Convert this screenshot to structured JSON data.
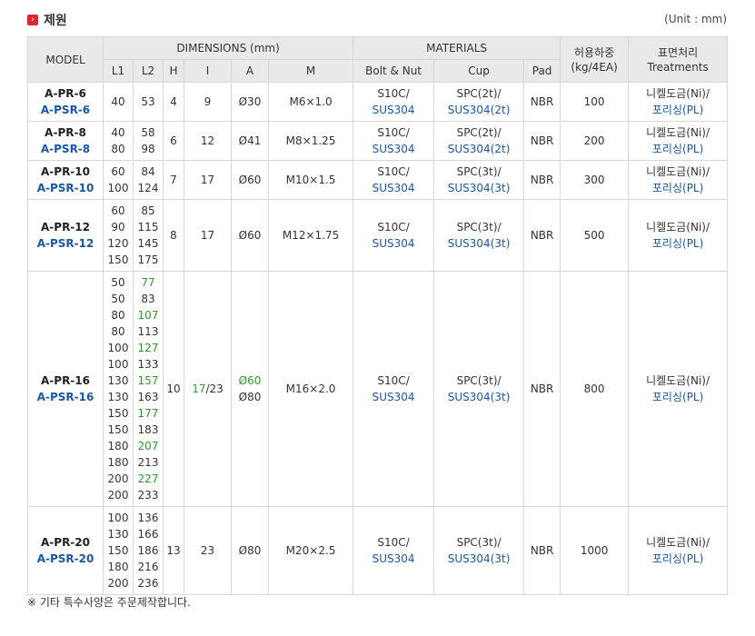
{
  "title": "제원",
  "title_icon": "arrow-right-icon",
  "unit": "(Unit : mm)",
  "headers": {
    "model": "MODEL",
    "dimensions": "DIMENSIONS (mm)",
    "materials": "MATERIALS",
    "load": "허용하중 (kg/4EA)",
    "treatment": "표면처리 Treatments",
    "l1": "L1",
    "l2": "L2",
    "h": "H",
    "i": "I",
    "a": "A",
    "m": "M",
    "bolt": "Bolt & Nut",
    "cup": "Cup",
    "pad": "Pad"
  },
  "rows": [
    {
      "model1": "A-PR-6",
      "model2": "A-PSR-6",
      "l1": [
        "40"
      ],
      "l2": [
        "53"
      ],
      "h": "4",
      "i": "9",
      "a": [
        "Ø30"
      ],
      "m": "M6×1.0",
      "bolt1": "S10C/",
      "bolt2": "SUS304",
      "cup1": "SPC(2t)/",
      "cup2": "SUS304(2t)",
      "pad": "NBR",
      "load": "100",
      "tr1": "니켈도금(Ni)/",
      "tr2": "포리싱(PL)"
    },
    {
      "model1": "A-PR-8",
      "model2": "A-PSR-8",
      "l1": [
        "40",
        "80"
      ],
      "l2": [
        "58",
        "98"
      ],
      "h": "6",
      "i": "12",
      "a": [
        "Ø41"
      ],
      "m": "M8×1.25",
      "bolt1": "S10C/",
      "bolt2": "SUS304",
      "cup1": "SPC(2t)/",
      "cup2": "SUS304(2t)",
      "pad": "NBR",
      "load": "200",
      "tr1": "니켈도금(Ni)/",
      "tr2": "포리싱(PL)"
    },
    {
      "model1": "A-PR-10",
      "model2": "A-PSR-10",
      "l1": [
        "60",
        "100"
      ],
      "l2": [
        "84",
        "124"
      ],
      "h": "7",
      "i": "17",
      "a": [
        "Ø60"
      ],
      "m": "M10×1.5",
      "bolt1": "S10C/",
      "bolt2": "SUS304",
      "cup1": "SPC(3t)/",
      "cup2": "SUS304(3t)",
      "pad": "NBR",
      "load": "300",
      "tr1": "니켈도금(Ni)/",
      "tr2": "포리싱(PL)"
    },
    {
      "model1": "A-PR-12",
      "model2": "A-PSR-12",
      "l1": [
        "60",
        "90",
        "120",
        "150"
      ],
      "l2": [
        "85",
        "115",
        "145",
        "175"
      ],
      "h": "8",
      "i": "17",
      "a": [
        "Ø60"
      ],
      "m": "M12×1.75",
      "bolt1": "S10C/",
      "bolt2": "SUS304",
      "cup1": "SPC(3t)/",
      "cup2": "SUS304(3t)",
      "pad": "NBR",
      "load": "500",
      "tr1": "니켈도금(Ni)/",
      "tr2": "포리싱(PL)"
    },
    {
      "model1": "A-PR-16",
      "model2": "A-PSR-16",
      "l1": [
        "50",
        "50",
        "80",
        "80",
        "100",
        "100",
        "130",
        "130",
        "150",
        "150",
        "180",
        "180",
        "200",
        "200"
      ],
      "l2": [
        "77",
        "83",
        "107",
        "113",
        "127",
        "133",
        "157",
        "163",
        "177",
        "183",
        "207",
        "213",
        "227",
        "233"
      ],
      "l2_green": [
        0,
        2,
        4,
        6,
        8,
        10,
        12
      ],
      "h": "10",
      "i_green": "17",
      "i_rest": "/23",
      "a": [
        "Ø60",
        "Ø80"
      ],
      "a_green": [
        0
      ],
      "m": "M16×2.0",
      "bolt1": "S10C/",
      "bolt2": "SUS304",
      "cup1": "SPC(3t)/",
      "cup2": "SUS304(3t)",
      "pad": "NBR",
      "load": "800",
      "tr1": "니켈도금(Ni)/",
      "tr2": "포리싱(PL)"
    },
    {
      "model1": "A-PR-20",
      "model2": "A-PSR-20",
      "l1": [
        "100",
        "130",
        "150",
        "180",
        "200"
      ],
      "l2": [
        "136",
        "166",
        "186",
        "216",
        "236"
      ],
      "h": "13",
      "i": "23",
      "a": [
        "Ø80"
      ],
      "m": "M20×2.5",
      "bolt1": "S10C/",
      "bolt2": "SUS304",
      "cup1": "SPC(3t)/",
      "cup2": "SUS304(3t)",
      "pad": "NBR",
      "load": "1000",
      "tr1": "니켈도금(Ni)/",
      "tr2": "포리싱(PL)"
    }
  ],
  "note": "※ 기타 특수사양은 주문제작합니다.",
  "colors": {
    "header_bg": "#e9e9e9",
    "blue": "#1a57a4",
    "green": "#2e9a2a",
    "icon_red": "#e0262c"
  }
}
